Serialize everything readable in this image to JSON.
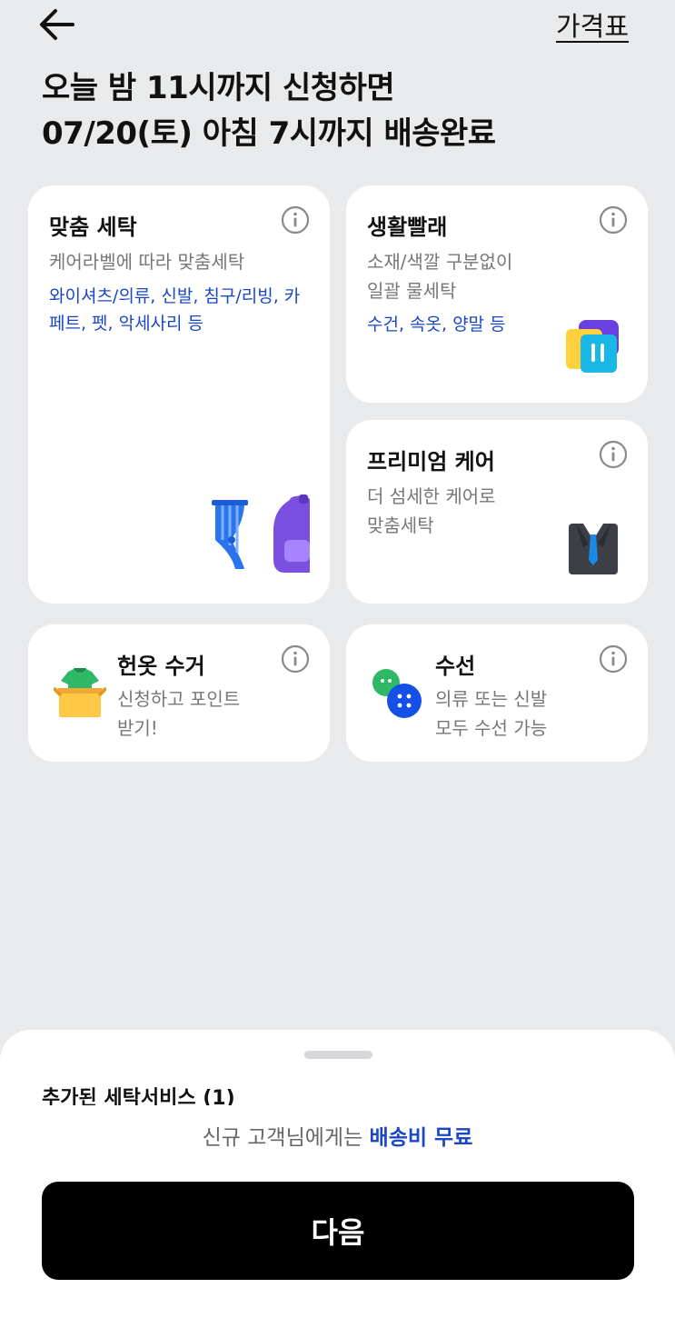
{
  "header": {
    "price_table_label": "가격표",
    "headline_line1": "오늘 밤 11시까지 신청하면",
    "headline_line2": "07/20(토) 아침 7시까지 배송완료"
  },
  "cards": {
    "custom_wash": {
      "title": "맞춤 세탁",
      "desc": "케어라벨에 따라 맞춤세탁",
      "tags_line1": "와이셔츠/의류, 신발, 침구/리빙, 카",
      "tags_line2": "페트, 펫, 악세사리 등"
    },
    "daily_laundry": {
      "title": "생활빨래",
      "desc_line1": "소재/색깔 구분없이",
      "desc_line2": "일괄 물세탁",
      "tags": "수건, 속옷, 양말 등"
    },
    "premium_care": {
      "title": "프리미엄 케어",
      "desc_line1": "더 섬세한 케어로",
      "desc_line2": "맞춤세탁"
    },
    "old_clothes": {
      "title": "헌옷 수거",
      "desc_line1": "신청하고 포인트",
      "desc_line2": "받기!"
    },
    "repair": {
      "title": "수선",
      "desc_line1": "의류 또는 신발",
      "desc_line2": "모두 수선 가능"
    }
  },
  "bottom_sheet": {
    "peek_title": "추가된 세탁서비스 (1)",
    "promo_prefix": "신규 고객님에게는",
    "promo_highlight": "배송비 무료",
    "next_label": "다음"
  },
  "colors": {
    "accent_blue": "#1a47c7",
    "background": "#e9eaec",
    "primary_button": "#000000"
  },
  "icons": [
    "back-arrow-icon",
    "info-icon",
    "curtain-icon",
    "backpack-icon",
    "laundry-basket-icon",
    "suit-icon",
    "clothes-box-icon",
    "buttons-icon"
  ]
}
